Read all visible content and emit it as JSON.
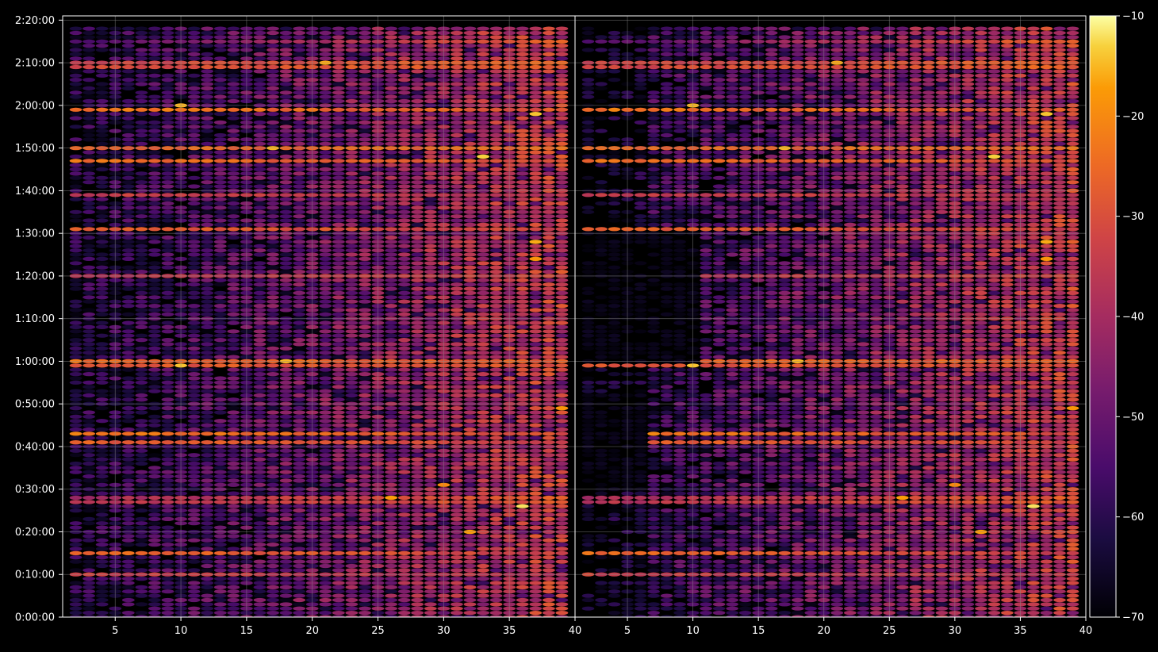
{
  "chart_data": {
    "type": "heatmap",
    "title": "",
    "xlabel": "",
    "ylabel": "",
    "grid": true,
    "colormap": "inferno",
    "colors": {
      "background": "#000000",
      "text": "#ffffff",
      "grid": "#8c8c8c",
      "axis": "#ffffff"
    },
    "panels": [
      {
        "id": "left",
        "xlim": [
          1,
          40
        ],
        "xticks": [
          "5",
          "10",
          "15",
          "20",
          "25",
          "30",
          "35",
          "40"
        ]
      },
      {
        "id": "right",
        "xlim": [
          1,
          40
        ],
        "xticks": [
          "5",
          "10",
          "15",
          "20",
          "25",
          "30",
          "35",
          "40"
        ]
      }
    ],
    "ylim_seconds": [
      0,
      8460
    ],
    "yticks": [
      "0:00:00",
      "0:10:00",
      "0:20:00",
      "0:30:00",
      "0:40:00",
      "0:50:00",
      "1:00:00",
      "1:10:00",
      "1:20:00",
      "1:30:00",
      "1:40:00",
      "1:50:00",
      "2:00:00",
      "2:10:00",
      "2:20:00"
    ],
    "colorbar": {
      "range": [
        -70,
        -10
      ],
      "ticks": [
        "−10",
        "−20",
        "−30",
        "−40",
        "−50",
        "−60",
        "−70"
      ]
    },
    "channels": {
      "first": 2,
      "last": 39
    },
    "row_spacing_seconds": 60,
    "strong_rows": [
      {
        "time": "0:15:00",
        "level": -25,
        "decay": 0.9
      },
      {
        "time": "0:10:00",
        "level": -33,
        "decay": 0.4
      },
      {
        "time": "0:28:00",
        "level": -40,
        "decay": -1.2
      },
      {
        "time": "0:27:00",
        "level": -38,
        "decay": -1.0
      },
      {
        "time": "0:41:00",
        "level": -27,
        "decay": 0.6
      },
      {
        "time": "0:43:00",
        "level": -22,
        "decay": 0.9
      },
      {
        "time": "0:59:00",
        "level": -28,
        "decay": 0.2
      },
      {
        "time": "1:00:00",
        "level": -24,
        "decay": 0.4
      },
      {
        "time": "1:20:00",
        "level": -38,
        "decay": -0.6
      },
      {
        "time": "1:31:00",
        "level": -26,
        "decay": 0.8
      },
      {
        "time": "1:39:00",
        "level": -34,
        "decay": 0.3
      },
      {
        "time": "1:47:00",
        "level": -24,
        "decay": 0.7
      },
      {
        "time": "1:50:00",
        "level": -26,
        "decay": -0.1
      },
      {
        "time": "1:59:00",
        "level": -23,
        "decay": 0.6
      },
      {
        "time": "2:09:00",
        "level": -32,
        "decay": -0.5
      },
      {
        "time": "2:10:00",
        "level": -34,
        "decay": -0.8
      },
      {
        "time": "2:15:00",
        "level": -55,
        "decay": -3.0
      }
    ],
    "hot_spots": [
      {
        "time": "1:48:00",
        "channel": 33,
        "value": -13
      },
      {
        "time": "2:10:00",
        "channel": 21,
        "value": -16
      },
      {
        "time": "2:00:00",
        "channel": 10,
        "value": -15
      },
      {
        "time": "1:58:00",
        "channel": 37,
        "value": -14
      },
      {
        "time": "1:50:00",
        "channel": 17,
        "value": -15
      },
      {
        "time": "1:28:00",
        "channel": 37,
        "value": -16
      },
      {
        "time": "1:24:00",
        "channel": 37,
        "value": -18
      },
      {
        "time": "0:59:00",
        "channel": 10,
        "value": -14
      },
      {
        "time": "1:00:00",
        "channel": 18,
        "value": -15
      },
      {
        "time": "0:26:00",
        "channel": 36,
        "value": -12
      },
      {
        "time": "0:28:00",
        "channel": 26,
        "value": -17
      },
      {
        "time": "0:20:00",
        "channel": 32,
        "value": -17
      },
      {
        "time": "0:49:00",
        "channel": 39,
        "value": -18
      },
      {
        "time": "0:31:00",
        "channel": 30,
        "value": -20
      }
    ],
    "quiet_regions": [
      {
        "panel": "right",
        "time_from": "1:00:00",
        "time_to": "1:30:00",
        "ch_from": 1,
        "ch_to": 10
      },
      {
        "panel": "right",
        "time_from": "0:30:00",
        "time_to": "0:52:00",
        "ch_from": 1,
        "ch_to": 6
      }
    ]
  }
}
